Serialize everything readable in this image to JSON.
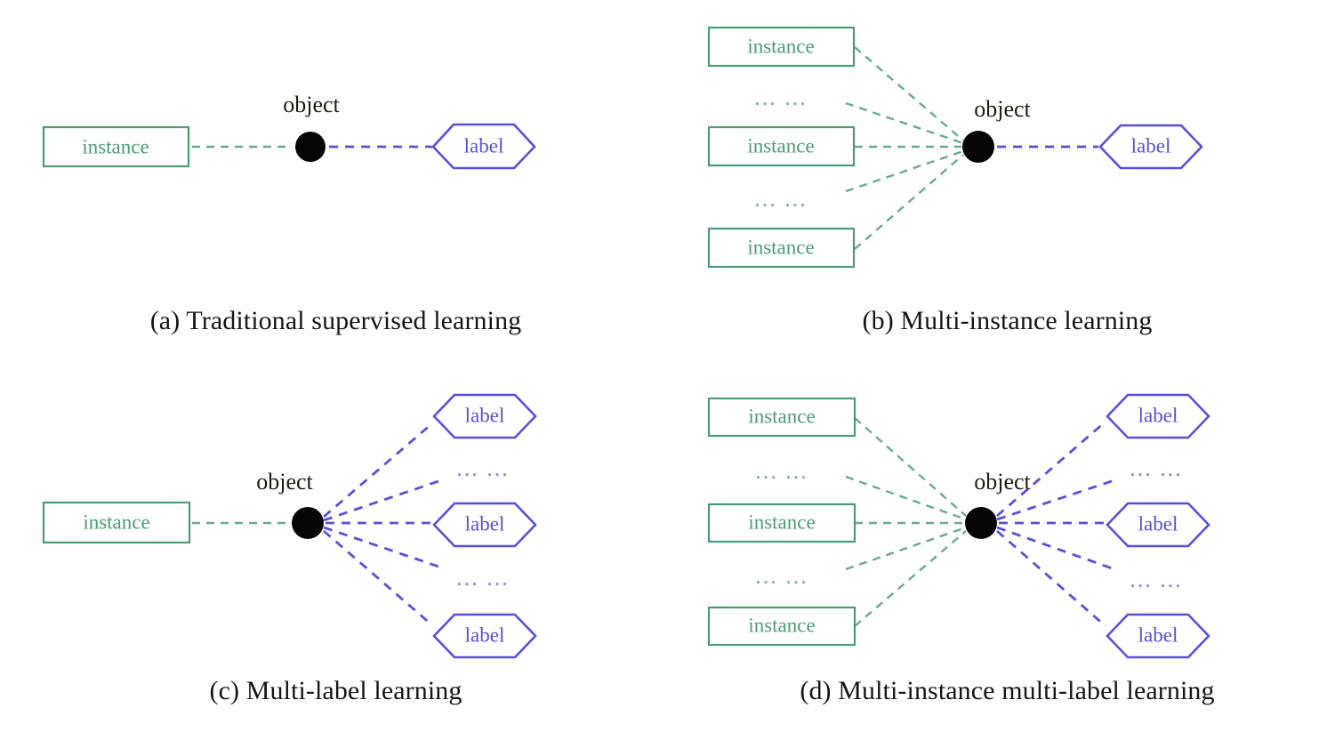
{
  "figure": {
    "background": "#ffffff",
    "colors": {
      "instance_stroke": "#4c9b78",
      "instance_text": "#4c9b78",
      "label_stroke": "#5b4fd4",
      "label_text": "#5b4fd4",
      "object_dot": "#060606",
      "object_text": "#1d1a17",
      "edge_green": "#6aa894",
      "edge_blue": "#5b4fd4",
      "ellipsis_green": "#7fa99a",
      "ellipsis_blue": "#8b86c9"
    },
    "node_labels": {
      "instance": "instance",
      "label": "label",
      "object": "object",
      "ellipsis": "... ..."
    }
  },
  "panels": [
    {
      "id": "a",
      "caption": "(a) Traditional supervised learning",
      "object_label": "object",
      "instances": [
        "instance"
      ],
      "labels": [
        "label"
      ],
      "left_ellipses": [],
      "right_ellipses": [],
      "green_edges": 1,
      "blue_edges": 1
    },
    {
      "id": "b",
      "caption": "(b) Multi-instance learning",
      "object_label": "object",
      "instances": [
        "instance",
        "instance",
        "instance"
      ],
      "labels": [
        "label"
      ],
      "left_ellipses": [
        "... ...",
        "... ..."
      ],
      "right_ellipses": [],
      "green_edges": 5,
      "blue_edges": 1
    },
    {
      "id": "c",
      "caption": "(c) Multi-label learning",
      "object_label": "object",
      "instances": [
        "instance"
      ],
      "labels": [
        "label",
        "label",
        "label"
      ],
      "left_ellipses": [],
      "right_ellipses": [
        "... ...",
        "... ..."
      ],
      "green_edges": 1,
      "blue_edges": 5
    },
    {
      "id": "d",
      "caption": "(d) Multi-instance multi-label learning",
      "object_label": "object",
      "instances": [
        "instance",
        "instance",
        "instance"
      ],
      "labels": [
        "label",
        "label",
        "label"
      ],
      "left_ellipses": [
        "... ...",
        "... ..."
      ],
      "right_ellipses": [
        "... ...",
        "... ..."
      ],
      "green_edges": 5,
      "blue_edges": 5
    }
  ]
}
